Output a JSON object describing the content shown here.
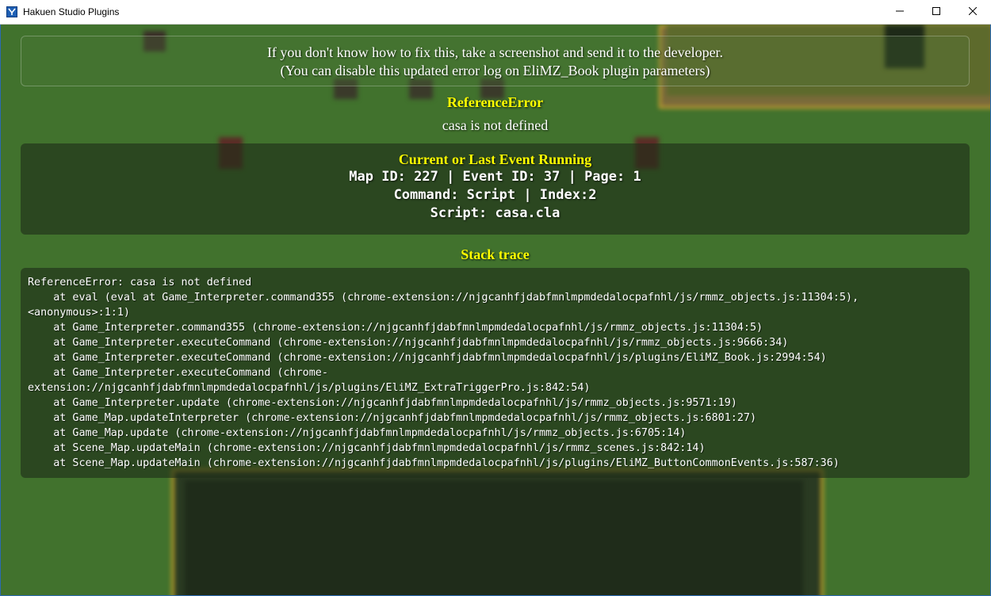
{
  "window": {
    "title": "Hakuen Studio Plugins",
    "icons": [
      "app-icon",
      "minimize-icon",
      "maximize-icon",
      "close-icon"
    ]
  },
  "error_screen": {
    "hint_line_1": "If you don't know how to fix this, take a screenshot and send it to the developer.",
    "hint_line_2": "(You can disable this updated error log on EliMZ_Book plugin parameters)",
    "error_name": "ReferenceError",
    "error_message": "casa is not defined",
    "event_section": {
      "heading": "Current or Last Event Running",
      "line_1": "Map ID: 227 | Event ID: 37 | Page: 1",
      "line_2": "Command: Script | Index:2",
      "line_3": "Script: casa.cla"
    },
    "stack_heading": "Stack trace",
    "stack_lines": [
      "ReferenceError: casa is not defined",
      "    at eval (eval at Game_Interpreter.command355 (chrome-extension://njgcanhfjdabfmnlmpmdedalocpafnhl/js/rmmz_objects.js:11304:5),",
      "<anonymous>:1:1)",
      "    at Game_Interpreter.command355 (chrome-extension://njgcanhfjdabfmnlmpmdedalocpafnhl/js/rmmz_objects.js:11304:5)",
      "    at Game_Interpreter.executeCommand (chrome-extension://njgcanhfjdabfmnlmpmdedalocpafnhl/js/rmmz_objects.js:9666:34)",
      "    at Game_Interpreter.executeCommand (chrome-extension://njgcanhfjdabfmnlmpmdedalocpafnhl/js/plugins/EliMZ_Book.js:2994:54)",
      "    at Game_Interpreter.executeCommand (chrome-",
      "extension://njgcanhfjdabfmnlmpmdedalocpafnhl/js/plugins/EliMZ_ExtraTriggerPro.js:842:54)",
      "    at Game_Interpreter.update (chrome-extension://njgcanhfjdabfmnlmpmdedalocpafnhl/js/rmmz_objects.js:9571:19)",
      "    at Game_Map.updateInterpreter (chrome-extension://njgcanhfjdabfmnlmpmdedalocpafnhl/js/rmmz_objects.js:6801:27)",
      "    at Game_Map.update (chrome-extension://njgcanhfjdabfmnlmpmdedalocpafnhl/js/rmmz_objects.js:6705:14)",
      "    at Scene_Map.updateMain (chrome-extension://njgcanhfjdabfmnlmpmdedalocpafnhl/js/rmmz_scenes.js:842:14)",
      "    at Scene_Map.updateMain (chrome-extension://njgcanhfjdabfmnlmpmdedalocpafnhl/js/plugins/EliMZ_ButtonCommonEvents.js:587:36)"
    ]
  }
}
